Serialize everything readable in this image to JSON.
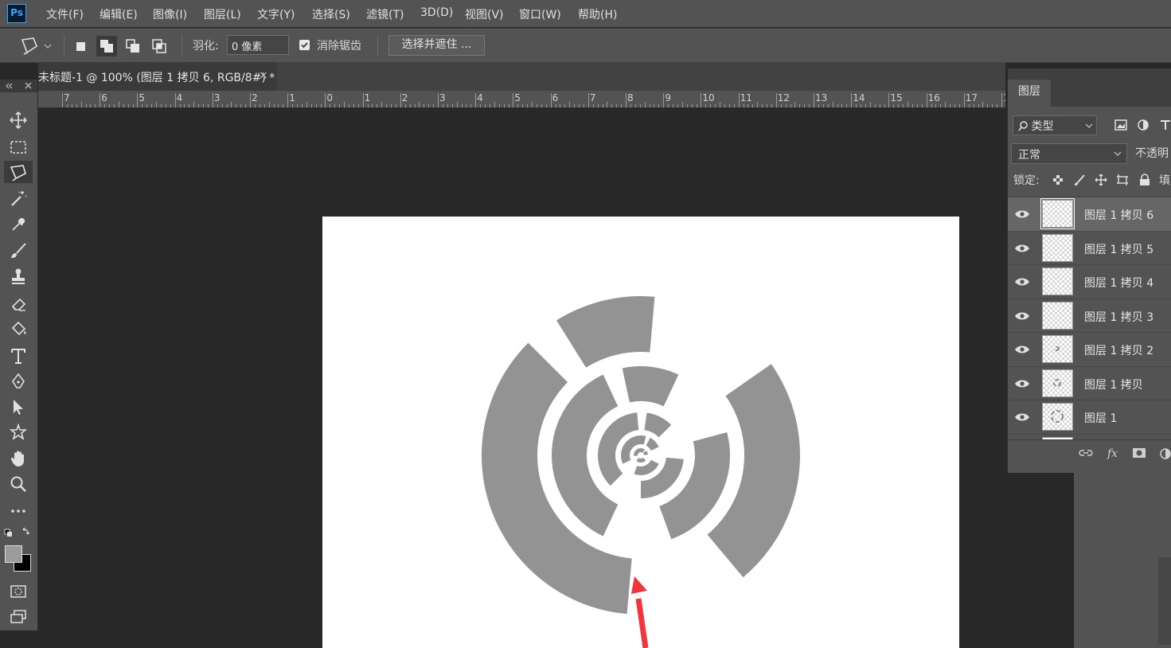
{
  "app": {
    "logo": "Ps"
  },
  "menu": [
    "文件(F)",
    "编辑(E)",
    "图像(I)",
    "图层(L)",
    "文字(Y)",
    "选择(S)",
    "滤镜(T)",
    "3D(D)",
    "视图(V)",
    "窗口(W)",
    "帮助(H)"
  ],
  "options": {
    "feather_label": "羽化:",
    "feather_value": "0 像素",
    "antialias_label": "消除锯齿",
    "antialias_checked": true,
    "select_mask_label": "选择并遮住 ..."
  },
  "document": {
    "tab_title": "未标题-1 @ 100% (图层 1 拷贝 6, RGB/8#) *",
    "close_glyph": "×"
  },
  "ruler": {
    "labels": [
      "7",
      "6",
      "5",
      "4",
      "3",
      "2",
      "1",
      "0",
      "1",
      "2",
      "3",
      "4",
      "5",
      "6",
      "7",
      "8",
      "9",
      "10",
      "11",
      "12",
      "13",
      "14",
      "15",
      "16",
      "17",
      "1"
    ]
  },
  "tools": [
    {
      "name": "move-tool"
    },
    {
      "name": "marquee-tool"
    },
    {
      "name": "polygonal-lasso-tool",
      "active": true
    },
    {
      "name": "magic-wand-tool"
    },
    {
      "name": "eyedropper-tool"
    },
    {
      "name": "brush-tool"
    },
    {
      "name": "clone-stamp-tool"
    },
    {
      "name": "eraser-tool"
    },
    {
      "name": "paint-bucket-tool"
    },
    {
      "name": "type-tool"
    },
    {
      "name": "pen-tool"
    },
    {
      "name": "path-selection-tool"
    },
    {
      "name": "custom-shape-tool"
    },
    {
      "name": "hand-tool"
    },
    {
      "name": "zoom-tool"
    },
    {
      "name": "more-tools"
    }
  ],
  "colors": {
    "foreground": "#9b9b9b",
    "background": "#000000",
    "shape_gray": "#939393",
    "arrow_red": "#f0353b"
  },
  "layers_panel": {
    "tab_label": "图层",
    "filter_label": "类型",
    "blend_mode": "正常",
    "opacity_label": "不透明",
    "lock_label": "锁定:",
    "fill_label": "填",
    "layers": [
      {
        "name": "图层 1 拷贝 6",
        "selected": true
      },
      {
        "name": "图层 1 拷贝 5",
        "selected": false
      },
      {
        "name": "图层 1 拷贝 4",
        "selected": false
      },
      {
        "name": "图层 1 拷贝 3",
        "selected": false
      },
      {
        "name": "图层 1 拷贝 2",
        "selected": false
      },
      {
        "name": "图层 1 拷贝",
        "selected": false
      },
      {
        "name": "图层 1",
        "selected": false
      }
    ]
  }
}
